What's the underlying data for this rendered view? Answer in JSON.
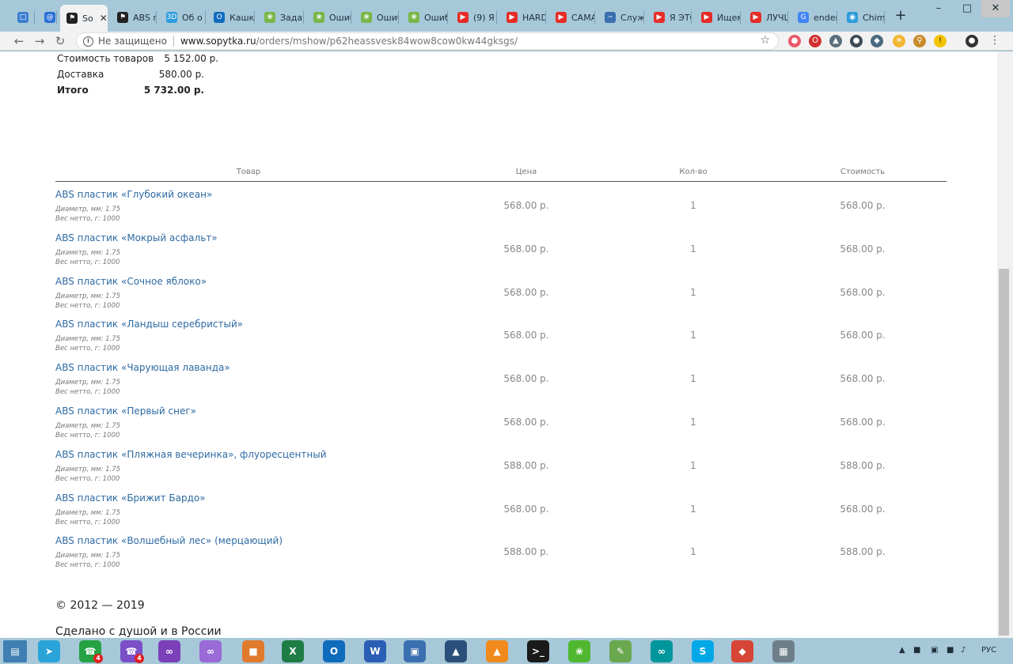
{
  "browser": {
    "tabs": [
      {
        "label": "",
        "icon": "chat-icon",
        "color": "#3b7ed0"
      },
      {
        "label": "",
        "icon": "at-icon",
        "color": "#2a6fd6"
      },
      {
        "label": "So",
        "icon": "flag-icon",
        "color": "#222222",
        "active": true
      },
      {
        "label": "ABS п",
        "icon": "flag-icon",
        "color": "#222222"
      },
      {
        "label": "Об о",
        "icon": "3d-icon",
        "color": "#2d9cdb"
      },
      {
        "label": "Кашк",
        "icon": "outlook-icon",
        "color": "#0f6cbd"
      },
      {
        "label": "Задач",
        "icon": "leaf-icon",
        "color": "#7ab648"
      },
      {
        "label": "Ошиб",
        "icon": "leaf-icon",
        "color": "#7ab648"
      },
      {
        "label": "Ошиб",
        "icon": "leaf-icon",
        "color": "#7ab648"
      },
      {
        "label": "Ошиб",
        "icon": "leaf-icon",
        "color": "#7ab648"
      },
      {
        "label": "(9) Я",
        "icon": "youtube-icon",
        "color": "#e52d27"
      },
      {
        "label": "HARD",
        "icon": "youtube-icon",
        "color": "#e52d27"
      },
      {
        "label": "САМА",
        "icon": "youtube-icon",
        "color": "#e52d27"
      },
      {
        "label": "Служ",
        "icon": "wave-icon",
        "color": "#3a6fb0"
      },
      {
        "label": "Я ЭТС",
        "icon": "youtube-icon",
        "color": "#e52d27"
      },
      {
        "label": "Ищем",
        "icon": "youtube-icon",
        "color": "#e52d27"
      },
      {
        "label": "ЛУЧШ",
        "icon": "youtube-icon",
        "color": "#e52d27"
      },
      {
        "label": "ender",
        "icon": "google-icon",
        "color": "#4285f4"
      },
      {
        "label": "Chim",
        "icon": "chimp-icon",
        "color": "#2d9cdb"
      }
    ],
    "address": {
      "security_label": "Не защищено",
      "host": "www.sopytka.ru",
      "path": "/orders/mshow/p62heassvesk84wow8cow0kw44gksgs/"
    }
  },
  "summary": {
    "goods_label": "Стоимость товаров",
    "goods_value": "5 152.00 р.",
    "delivery_label": "Доставка",
    "delivery_value": "580.00 р.",
    "total_label": "Итого",
    "total_value": "5 732.00 р."
  },
  "table": {
    "headers": {
      "product": "Товар",
      "price": "Цена",
      "qty": "Кол-во",
      "cost": "Стоимость"
    },
    "items": [
      {
        "name": "ABS пластик «Глубокий океан»",
        "attr1": "Диаметр, мм: 1.75",
        "attr2": "Вес нетто, г: 1000",
        "price": "568.00 р.",
        "qty": "1",
        "cost": "568.00 р."
      },
      {
        "name": "ABS пластик «Мокрый асфальт»",
        "attr1": "Диаметр, мм: 1.75",
        "attr2": "Вес нетто, г: 1000",
        "price": "568.00 р.",
        "qty": "1",
        "cost": "568.00 р."
      },
      {
        "name": "ABS пластик «Сочное яблоко»",
        "attr1": "Диаметр, мм: 1.75",
        "attr2": "Вес нетто, г: 1000",
        "price": "568.00 р.",
        "qty": "1",
        "cost": "568.00 р."
      },
      {
        "name": "ABS пластик «Ландыш серебристый»",
        "attr1": "Диаметр, мм: 1.75",
        "attr2": "Вес нетто, г: 1000",
        "price": "568.00 р.",
        "qty": "1",
        "cost": "568.00 р."
      },
      {
        "name": "ABS пластик «Чарующая лаванда»",
        "attr1": "Диаметр, мм: 1.75",
        "attr2": "Вес нетто, г: 1000",
        "price": "568.00 р.",
        "qty": "1",
        "cost": "568.00 р."
      },
      {
        "name": "ABS пластик «Первый снег»",
        "attr1": "Диаметр, мм: 1.75",
        "attr2": "Вес нетто, г: 1000",
        "price": "568.00 р.",
        "qty": "1",
        "cost": "568.00 р."
      },
      {
        "name": "ABS пластик «Пляжная вечеринка», флуоресцентный",
        "attr1": "Диаметр, мм: 1.75",
        "attr2": "Вес нетто, г: 1000",
        "price": "588.00 р.",
        "qty": "1",
        "cost": "588.00 р."
      },
      {
        "name": "ABS пластик «Брижит Бардо»",
        "attr1": "Диаметр, мм: 1.75",
        "attr2": "Вес нетто, г: 1000",
        "price": "568.00 р.",
        "qty": "1",
        "cost": "568.00 р."
      },
      {
        "name": "ABS пластик «Волшебный лес» (мерцающий)",
        "attr1": "Диаметр, мм: 1.75",
        "attr2": "Вес нетто, г: 1000",
        "price": "588.00 р.",
        "qty": "1",
        "cost": "588.00 р."
      }
    ]
  },
  "footer": {
    "copyright": "© 2012 — 2019",
    "made_with": "Сделано с душой и в России"
  },
  "taskbar": {
    "apps": [
      {
        "icon": "telegram-icon",
        "color": "#2aa3d8",
        "badge": ""
      },
      {
        "icon": "whatsapp-icon",
        "color": "#25a244",
        "badge": "4"
      },
      {
        "icon": "viber-icon",
        "color": "#7b4fc8",
        "badge": "4"
      },
      {
        "icon": "visual-studio-icon",
        "color": "#7b3fb8",
        "badge": ""
      },
      {
        "icon": "visual-studio-icon",
        "color": "#9a6ad6",
        "badge": ""
      },
      {
        "icon": "paint-icon",
        "color": "#e07a2c",
        "badge": ""
      },
      {
        "icon": "excel-icon",
        "color": "#1e7d44",
        "badge": ""
      },
      {
        "icon": "outlook-icon",
        "color": "#0f6cbd",
        "badge": ""
      },
      {
        "icon": "word-icon",
        "color": "#2b5fb5",
        "badge": ""
      },
      {
        "icon": "network-icon",
        "color": "#3a6fb0",
        "badge": ""
      },
      {
        "icon": "tree-icon",
        "color": "#2a4f7a",
        "badge": ""
      },
      {
        "icon": "vlc-icon",
        "color": "#f08a1c",
        "badge": ""
      },
      {
        "icon": "terminal-icon",
        "color": "#1a1a1a",
        "badge": ""
      },
      {
        "icon": "icq-icon",
        "color": "#4fb830",
        "badge": ""
      },
      {
        "icon": "notepad-icon",
        "color": "#6aa84f",
        "badge": ""
      },
      {
        "icon": "arduino-icon",
        "color": "#00979c",
        "badge": ""
      },
      {
        "icon": "skype-icon",
        "color": "#00a8e8",
        "badge": ""
      },
      {
        "icon": "slicer-icon",
        "color": "#d64535",
        "badge": ""
      },
      {
        "icon": "calculator-icon",
        "color": "#6f7f8a",
        "badge": ""
      }
    ],
    "language": "РУС"
  }
}
